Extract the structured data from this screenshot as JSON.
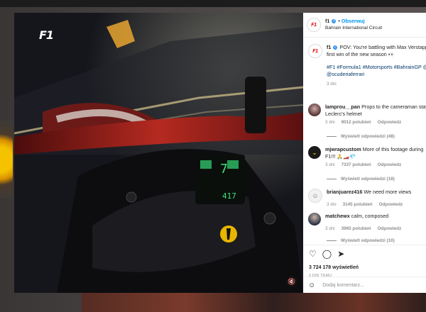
{
  "post": {
    "author": "f1",
    "follow_label": "Obserwuj",
    "location": "Bahrain International Circuit",
    "caption_author": "f1",
    "caption_line1": "POV: You're battling with Max Verstapp",
    "caption_line2": "first win of the new season 👀",
    "tags_line1": "#F1 #Formula1 #Motorsports #BahrainGP @",
    "tags_line2": "@scuderiaferrari",
    "caption_age": "3 dni",
    "likes": "3 724 178 wyświetleń",
    "posted_ago": "3 DNI TEMU",
    "comment_placeholder": "Dodaj komentarz..."
  },
  "comments": [
    {
      "user": "lamprou__pan",
      "text1": "Props to the cameraman stay",
      "text2": "Leclerc's helmet",
      "age": "3 dni",
      "likes": "9012 polubień",
      "reply": "Odpowiedz",
      "replies": "Wyświetl odpowiedzi (48)"
    },
    {
      "user": "mjwrapcustom",
      "text1": "More of this footage during",
      "text2": "F1!!! 🙏🏎️💎",
      "age": "3 dni",
      "likes": "7337 polubień",
      "reply": "Odpowiedz",
      "replies": "Wyświetl odpowiedzi (18)"
    },
    {
      "user": "brianjuarez416",
      "text1": "We need more views",
      "age": "3 dni",
      "likes": "3145 polubień",
      "reply": "Odpowiedz"
    },
    {
      "user": "matchewx",
      "text1": "calm, composed",
      "age": "3 dni",
      "likes": "3965 polubień",
      "reply": "Odpowiedz",
      "replies": "Wyświetl odpowiedzi (10)"
    }
  ],
  "video": {
    "logo": "F1",
    "dash_values": [
      "7",
      "417"
    ],
    "colors": {
      "accent": "#e10600",
      "link": "#0095f6",
      "dash": "#3fe07a"
    }
  },
  "icons": {
    "like": "heart-icon",
    "comment": "comment-icon",
    "share": "share-icon",
    "emoji": "emoji-icon",
    "mute": "speaker-muted-icon"
  }
}
